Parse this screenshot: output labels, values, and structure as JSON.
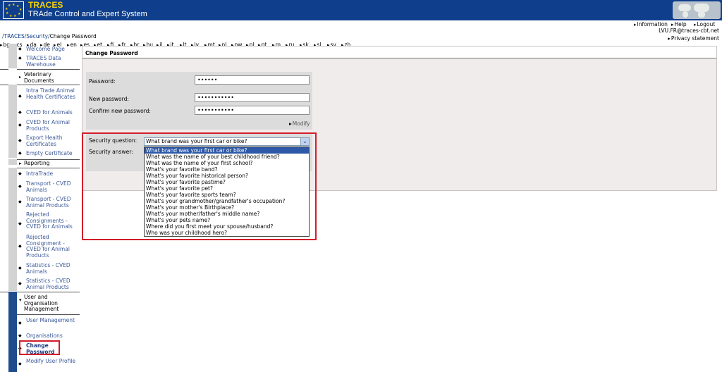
{
  "header": {
    "app_title": "TRACES",
    "app_subtitle": "TRAde Control and Expert System"
  },
  "languages": [
    "bg",
    "cs",
    "da",
    "de",
    "el",
    "en",
    "es",
    "et",
    "fi",
    "fr",
    "hr",
    "hu",
    "il",
    "it",
    "lt",
    "lv",
    "mt",
    "nl",
    "nw",
    "pl",
    "pt",
    "ro",
    "ru",
    "sk",
    "sl",
    "sv",
    "zh"
  ],
  "top_links": {
    "information": "Information",
    "help": "Help",
    "logout": "Logout",
    "user": "LVU.FR@traces-cbt.net",
    "privacy": "Privacy statement"
  },
  "breadcrumb": {
    "root": "/TRACES/",
    "section": "Security",
    "sep": "/",
    "current": "Change Password"
  },
  "sidebar": {
    "welcome": "Welcome Page",
    "warehouse": "TRACES Data Warehouse",
    "vet_docs": "Veterinary Documents",
    "intra_trade_cert": "Intra Trade Animal Health Certificates",
    "cved_animals": "CVED for Animals",
    "cved_products": "CVED for Animal Products",
    "export_health": "Export Health Certificates",
    "empty_cert": "Empty Certificate",
    "reporting": "Reporting",
    "intratrade": "IntraTrade",
    "transport_animals": "Transport - CVED Animals",
    "transport_products": "Transport - CVED Animal Products",
    "rejected_animals": "Rejected Consignments - CVED for Animals",
    "rejected_products": "Rejected Consignment - CVED for Animal Products",
    "stats_animals": "Statistics - CVED Animals",
    "stats_products": "Statistics - CVED Animal Products",
    "user_org": "User and Organisation Management",
    "user_mgmt": "User Management",
    "organisations": "Organisations",
    "change_password": "Change Password",
    "modify_profile": "Modify User Profile"
  },
  "main": {
    "title": "Change Password",
    "password_label": "Password:",
    "password_value": "••••••",
    "new_password_label": "New password:",
    "new_password_value": "•••••••••••",
    "confirm_label": "Confirm new password:",
    "confirm_value": "•••••••••••",
    "modify": "Modify",
    "security_question_label": "Security question:",
    "security_answer_label": "Security answer:",
    "selected_question": "What brand was your first car or bike?",
    "options": [
      "What brand was your first car or bike?",
      "What was the name of your best childhood friend?",
      "What was the name of your first school?",
      "What's your favorite band?",
      "What's your favorite historical person?",
      "What's your favorite pastime?",
      "What's your favorite pet?",
      "What's your favorite sports team?",
      "What's your grandmother/grandfather's occupation?",
      "What's your mother's Birthplace?",
      "What's your mother/father's middle name?",
      "What's your pets name?",
      "Where did you first meet your spouse/husband?",
      "Who was your childhood hero?"
    ]
  },
  "colors": {
    "header_blue": "#0f3f8c",
    "title_yellow": "#f5d000",
    "link_blue": "#3c5a99",
    "highlight_red": "#d21e2a",
    "selected_option": "#2d59a8"
  }
}
